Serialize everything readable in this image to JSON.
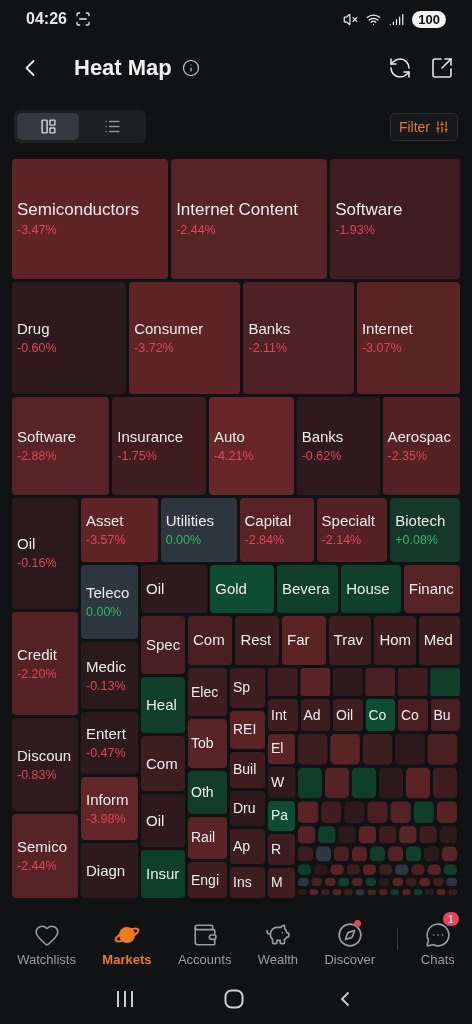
{
  "status_bar": {
    "time": "04:26",
    "battery": "100"
  },
  "header": {
    "title": "Heat Map"
  },
  "view_toggle": [
    {
      "kind": "treemap",
      "selected": true
    },
    {
      "kind": "list",
      "selected": false
    }
  ],
  "filter": {
    "label": "Filter"
  },
  "heatmap": {
    "row_1": [
      {
        "label": "Semiconductors",
        "change": "-3.47%",
        "gain": false,
        "color": "#5e2427"
      },
      {
        "label": "Internet Content",
        "change": "-2.44%",
        "gain": false,
        "color": "#562326"
      },
      {
        "label": "Software",
        "change": "-1.93%",
        "gain": false,
        "color": "#3f1d20"
      }
    ],
    "row_2": [
      {
        "label": "Drug",
        "change": "-0.60%",
        "gain": false,
        "color": "#2e1a1c"
      },
      {
        "label": "Consumer",
        "change": "-3.72%",
        "gain": false,
        "color": "#5e2427"
      },
      {
        "label": "Banks",
        "change": "-2.11%",
        "gain": false,
        "color": "#4e2124"
      },
      {
        "label": "Internet",
        "change": "-3.07%",
        "gain": false,
        "color": "#5a2326"
      }
    ],
    "row_3": [
      {
        "label": "Software",
        "change": "-2.88%",
        "gain": false,
        "color": "#572326"
      },
      {
        "label": "Insurance",
        "change": "-1.75%",
        "gain": false,
        "color": "#3e1d1f"
      },
      {
        "label": "Auto",
        "change": "-4.21%",
        "gain": false,
        "color": "#672629"
      },
      {
        "label": "Banks",
        "change": "-0.62%",
        "gain": false,
        "color": "#2e1a1c"
      },
      {
        "label": "Aerospac",
        "change": "-2.35%",
        "gain": false,
        "color": "#542225"
      }
    ],
    "column_1": [
      {
        "label": "Oil",
        "change": "-0.16%",
        "gain": false,
        "color": "#2a1a1b"
      },
      {
        "label": "Credit",
        "change": "-2.20%",
        "gain": false,
        "color": "#552225"
      },
      {
        "label": "Discoun",
        "change": "-0.83%",
        "gain": false,
        "color": "#2f1b1c"
      },
      {
        "label": "Semico",
        "change": "-2.44%",
        "gain": false,
        "color": "#562326"
      }
    ],
    "row_4": [
      {
        "label": "Asset",
        "change": "-3.57%",
        "gain": false,
        "color": "#5e2427"
      },
      {
        "label": "Utilities",
        "change": "0.00%",
        "gain": true,
        "color": "#2e363f"
      },
      {
        "label": "Capital",
        "change": "-2.84%",
        "gain": false,
        "color": "#572326"
      },
      {
        "label": "Specialt",
        "change": "-2.14%",
        "gain": false,
        "color": "#542225"
      },
      {
        "label": "Biotech",
        "change": "+0.08%",
        "gain": true,
        "color": "#15382a"
      }
    ],
    "column_2": [
      {
        "label": "Teleco",
        "change": "0.00%",
        "gain": true,
        "color": "#2e363f"
      },
      {
        "label": "Medic",
        "change": "-0.13%",
        "gain": false,
        "color": "#2a1a1b"
      },
      {
        "label": "Entert",
        "change": "-0.47%",
        "gain": false,
        "color": "#2d1a1c"
      },
      {
        "label": "Inform",
        "change": "-3.98%",
        "gain": false,
        "color": "#622528"
      },
      {
        "label": "Diagn",
        "color": "#2e1a1c"
      }
    ],
    "row_5": [
      {
        "label": "Oil",
        "color": "#2e1a1c"
      },
      {
        "label": "Gold",
        "color": "#0f4d33"
      },
      {
        "label": "Bevera",
        "color": "#0f3f2b"
      },
      {
        "label": "House",
        "color": "#0f402c"
      },
      {
        "label": "Financ",
        "color": "#562326"
      }
    ],
    "column_3": [
      {
        "label": "Spec",
        "color": "#4a1f22"
      },
      {
        "label": "Heal",
        "color": "#113d2b"
      },
      {
        "label": "Com",
        "color": "#3e1d1f"
      },
      {
        "label": "Oil",
        "color": "#2e1a1c"
      },
      {
        "label": "Insur",
        "color": "#0f3f2b"
      }
    ],
    "row_6": [
      {
        "label": "Com",
        "color": "#4a1f22"
      },
      {
        "label": "Rest",
        "color": "#3e1d1f"
      },
      {
        "label": "Far",
        "color": "#5a2326"
      },
      {
        "label": "Trav",
        "color": "#3e1d1f"
      },
      {
        "label": "Hom",
        "color": "#3e1d1f"
      },
      {
        "label": "Med",
        "color": "#3e1d1f"
      }
    ],
    "column_4": [
      {
        "label": "Elec",
        "color": "#3e1d1f"
      },
      {
        "label": "Tob",
        "color": "#5a2326"
      },
      {
        "label": "Oth",
        "color": "#123d2b"
      },
      {
        "label": "Rail",
        "color": "#5a2326"
      },
      {
        "label": "Engi",
        "color": "#3e1d1f"
      }
    ],
    "column_5": [
      {
        "label": "Sp",
        "color": "#3e1d1f"
      },
      {
        "label": "REI",
        "color": "#5a2326"
      },
      {
        "label": "Buil",
        "color": "#3e1d1f"
      },
      {
        "label": "Dru",
        "color": "#2e1a1c"
      },
      {
        "label": "Ap",
        "color": "#3e1d1f"
      },
      {
        "label": "Ins",
        "color": "#3e1d1f"
      }
    ],
    "row_7": [
      {
        "label": "Int",
        "color": "#3e1d1f"
      },
      {
        "label": "Ad",
        "color": "#3e1d1f"
      },
      {
        "label": "Oil",
        "color": "#3e1d1f"
      },
      {
        "label": "Co",
        "color": "#0f4d33"
      },
      {
        "label": "Co",
        "color": "#4a1f22"
      },
      {
        "label": "Bu",
        "color": "#4a1f22"
      }
    ],
    "column_6": [
      {
        "label": "El",
        "color": "#5a2326"
      },
      {
        "label": "W",
        "color": "#2e1a1c"
      },
      {
        "label": "Pa",
        "color": "#0f4d33"
      },
      {
        "label": "R",
        "color": "#3e1d1f"
      },
      {
        "label": "M",
        "color": "#3e1d1f"
      }
    ]
  },
  "nav": [
    {
      "kind": "watchlists",
      "label": "Watchlists",
      "selected": false
    },
    {
      "kind": "markets",
      "label": "Markets",
      "selected": true
    },
    {
      "kind": "accounts",
      "label": "Accounts",
      "selected": false
    },
    {
      "kind": "wealth",
      "label": "Wealth",
      "selected": false
    },
    {
      "kind": "discover",
      "label": "Discover",
      "selected": false,
      "dot": true
    },
    {
      "kind": "chats",
      "label": "Chats",
      "selected": false,
      "badge": "1"
    }
  ]
}
